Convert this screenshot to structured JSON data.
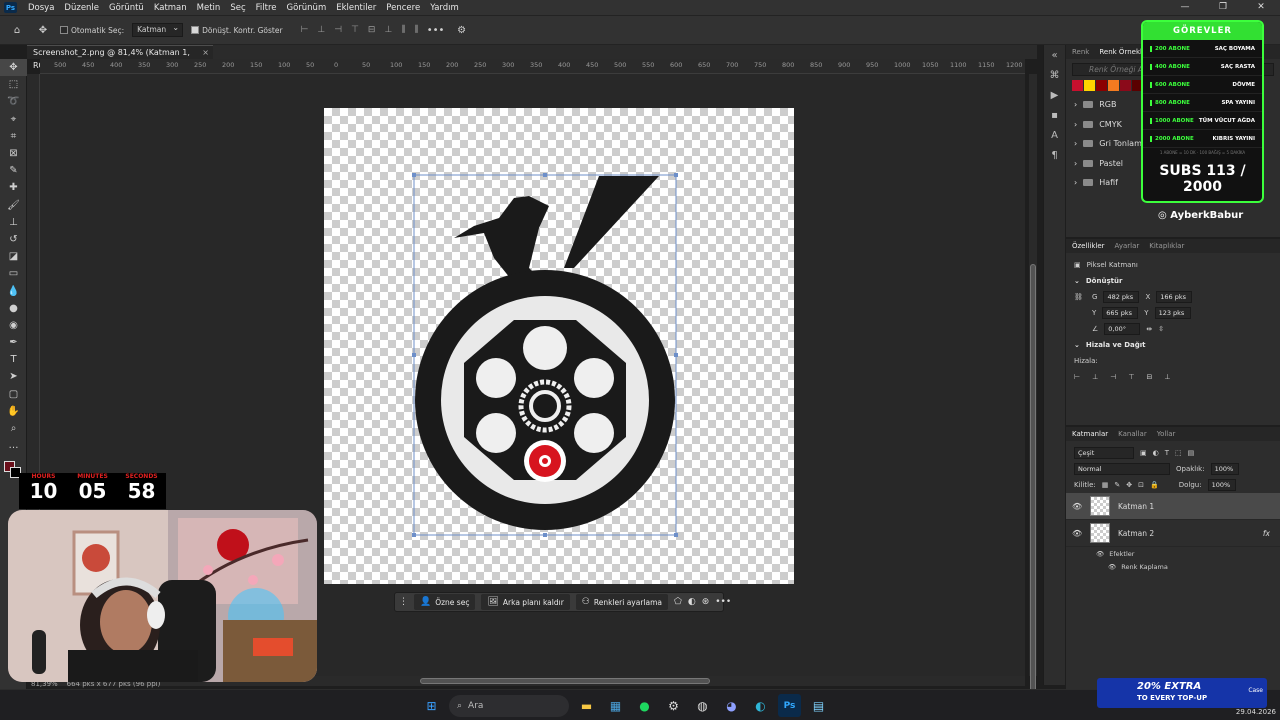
{
  "app": {
    "logo": "Ps"
  },
  "menu": [
    "Dosya",
    "Düzenle",
    "Görüntü",
    "Katman",
    "Metin",
    "Seç",
    "Filtre",
    "Görünüm",
    "Eklentiler",
    "Pencere",
    "Yardım"
  ],
  "window_controls": [
    "—",
    "❐",
    "✕"
  ],
  "options": {
    "auto_select_label": "Otomatik Seç:",
    "auto_select_value": "Katman",
    "transform_controls_label": "Dönüşt. Kontr. Göster",
    "more": "•••"
  },
  "document_tab": {
    "title": "Screenshot_2.png @ 81,4% (Katman 1, RGB/8#) *",
    "close": "×"
  },
  "ruler_marks": [
    "500",
    "450",
    "400",
    "350",
    "300",
    "250",
    "200",
    "150",
    "100",
    "50",
    "0",
    "50",
    "100",
    "150",
    "200",
    "250",
    "300",
    "350",
    "400",
    "450",
    "500",
    "550",
    "600",
    "650",
    "700",
    "750",
    "800",
    "850",
    "900",
    "950",
    "1000",
    "1050",
    "1100",
    "1150",
    "1200",
    "1250"
  ],
  "status": {
    "zoom": "81,39%",
    "doc": "664 pks x 677 pks (96 ppi)"
  },
  "context_bar": {
    "subject_select": "Özne seç",
    "remove_bg": "Arka planı kaldır",
    "color_adjust": "Renkleri ayarlama",
    "more": "•••"
  },
  "swatches_panel": {
    "tabs": [
      "Renk",
      "Renk Örnekleri"
    ],
    "search_placeholder": "Renk Örneği A",
    "colors": [
      "#c8102e",
      "#ffd400",
      "#8b0000",
      "#f47b20",
      "#8b0a1a",
      "#5a0000"
    ],
    "folders": [
      "RGB",
      "CMYK",
      "Gri Tonlama",
      "Pastel",
      "Hafif"
    ]
  },
  "properties": {
    "tabs": [
      "Özellikler",
      "Ayarlar",
      "Kitaplıklar"
    ],
    "layer_type": "Piksel Katmanı",
    "transform_heading": "Dönüştür",
    "w_label": "G",
    "w_value": "482 pks",
    "x_label": "X",
    "x_value": "166 pks",
    "h_label": "Y",
    "h_value": "665 pks",
    "y_label": "Y",
    "y_value": "123 pks",
    "angle": "0,00°",
    "align_heading": "Hizala ve Dağıt",
    "align_label": "Hizala:"
  },
  "layers": {
    "tabs": [
      "Katmanlar",
      "Kanallar",
      "Yollar"
    ],
    "filter_kind": "Çeşit",
    "blend_mode": "Normal",
    "opacity_label": "Opaklık:",
    "opacity_value": "100%",
    "lock_label": "Kilitle:",
    "fill_label": "Dolgu:",
    "fill_value": "100%",
    "items": [
      {
        "name": "Katman 1"
      },
      {
        "name": "Katman 2",
        "fx": "fx"
      }
    ],
    "effects_label": "Efektler",
    "effect_name": "Renk Kaplama"
  },
  "overlay": {
    "title": "GÖREVLER",
    "tasks": [
      {
        "subs": "200 ABONE",
        "task": "SAÇ BOYAMA"
      },
      {
        "subs": "400 ABONE",
        "task": "SAÇ RASTA"
      },
      {
        "subs": "600 ABONE",
        "task": "DÖVME"
      },
      {
        "subs": "800 ABONE",
        "task": "SPA YAYINI"
      },
      {
        "subs": "1000 ABONE",
        "task": "TÜM VÜCUT AĞDA"
      },
      {
        "subs": "2000 ABONE",
        "task": "KIBRIS YAYINI"
      }
    ],
    "fine_print": "1 ABONE = 10 DK  ·  100 BAĞIŞ = 5 DAKİKA",
    "subs_count": "SUBS 113 / 2000",
    "handle": "AyberkBabur"
  },
  "timer": {
    "hours_label": "HOURS",
    "hours": "10",
    "minutes_label": "MINUTES",
    "minutes": "05",
    "seconds_label": "SECONDS",
    "seconds": "58"
  },
  "taskbar": {
    "search": "Ara",
    "date": "29.04.2026"
  },
  "ad": {
    "headline": "20% EXTRA",
    "sub": "TO EVERY TOP-UP",
    "brand": "Case"
  }
}
